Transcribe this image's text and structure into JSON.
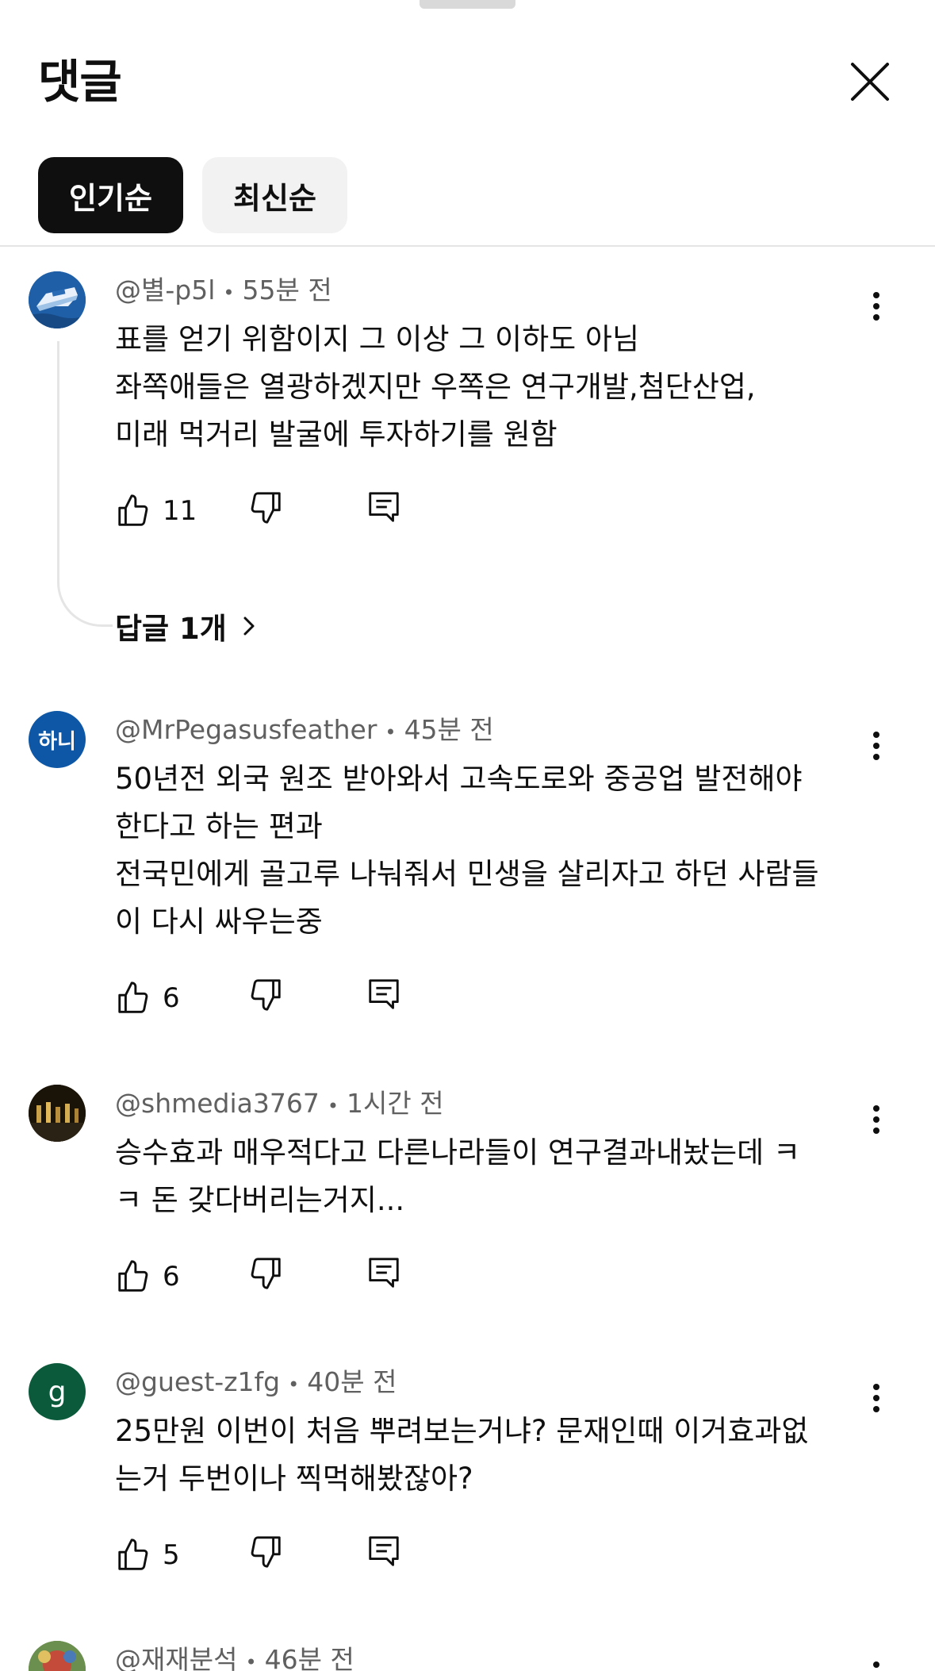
{
  "header": {
    "title": "댓글"
  },
  "sort": {
    "popular": "인기순",
    "newest": "최신순"
  },
  "comments": [
    {
      "author": "@별-p5l",
      "time": "55분 전",
      "text": "표를 얻기 위함이지 그 이상 그 이하도 아님\n좌쪽애들은 열광하겠지만 우쪽은 연구개발,첨단산업,\n미래 먹거리 발굴에 투자하기를 원함",
      "likes": "11",
      "replies_label": "답글 1개",
      "avatar_color": "#1f5fa8"
    },
    {
      "author": "@MrPegasusfeather",
      "time": "45분 전",
      "text": "50년전 외국 원조 받아와서 고속도로와 중공업 발전해야\n한다고 하는 편과\n전국민에게 골고루 나눠줘서 민생을 살리자고 하던 사람들\n이 다시 싸우는중",
      "likes": "6",
      "avatar_text": "하니",
      "avatar_color": "#0d57a6"
    },
    {
      "author": "@shmedia3767",
      "time": "1시간 전",
      "text": "승수효과 매우적다고 다른나라들이 연구결과내놨는데 ㅋ\nㅋ 돈 갖다버리는거지...",
      "likes": "6",
      "avatar_color": "#1a1408"
    },
    {
      "author": "@guest-z1fg",
      "time": "40분 전",
      "text": "25만원 이번이 처음 뿌려보는거냐? 문재인때 이거효과없\n는거 두번이나 찍먹해봤잖아?",
      "likes": "5",
      "avatar_text": "g",
      "avatar_color": "#0b5a3c"
    },
    {
      "author": "@재재분석",
      "time": "46분 전",
      "avatar_color": "#6b8f4e"
    }
  ]
}
